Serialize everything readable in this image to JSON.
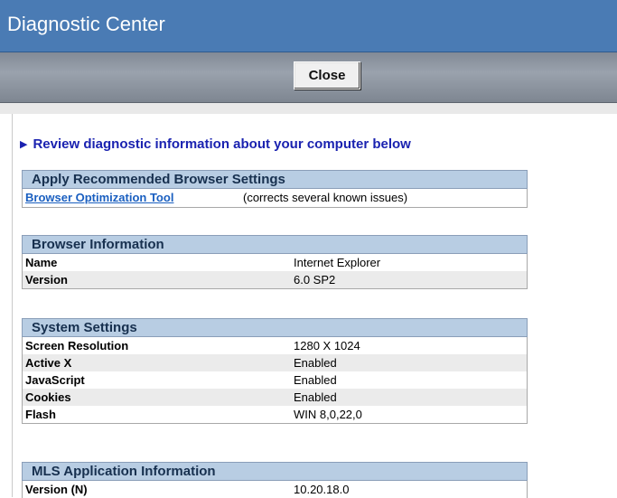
{
  "window": {
    "title": "Diagnostic Center"
  },
  "toolbar": {
    "close_label": "Close"
  },
  "intro": {
    "arrow": "▶",
    "text": "Review diagnostic information about your computer below"
  },
  "recommended": {
    "heading": "Apply Recommended Browser Settings",
    "link_label": "Browser Optimization Tool",
    "link_note": "(corrects several known issues)"
  },
  "browser_info": {
    "heading": "Browser Information",
    "rows": [
      {
        "label": "Name",
        "value": "Internet Explorer"
      },
      {
        "label": "Version",
        "value": "6.0 SP2"
      }
    ]
  },
  "system_settings": {
    "heading": "System Settings",
    "rows": [
      {
        "label": "Screen Resolution",
        "value": "1280 X 1024"
      },
      {
        "label": "Active X",
        "value": "Enabled"
      },
      {
        "label": "JavaScript",
        "value": "Enabled"
      },
      {
        "label": "Cookies",
        "value": "Enabled"
      },
      {
        "label": "Flash",
        "value": "WIN 8,0,22,0"
      }
    ]
  },
  "mls_info": {
    "heading": "MLS Application Information",
    "rows": [
      {
        "label": "Version (N)",
        "value": "10.20.18.0"
      }
    ]
  },
  "colors": {
    "title_bar": "#4a7bb4",
    "section_header": "#b8cde3",
    "link": "#1a5fc0",
    "intro_text": "#1a22b0"
  }
}
